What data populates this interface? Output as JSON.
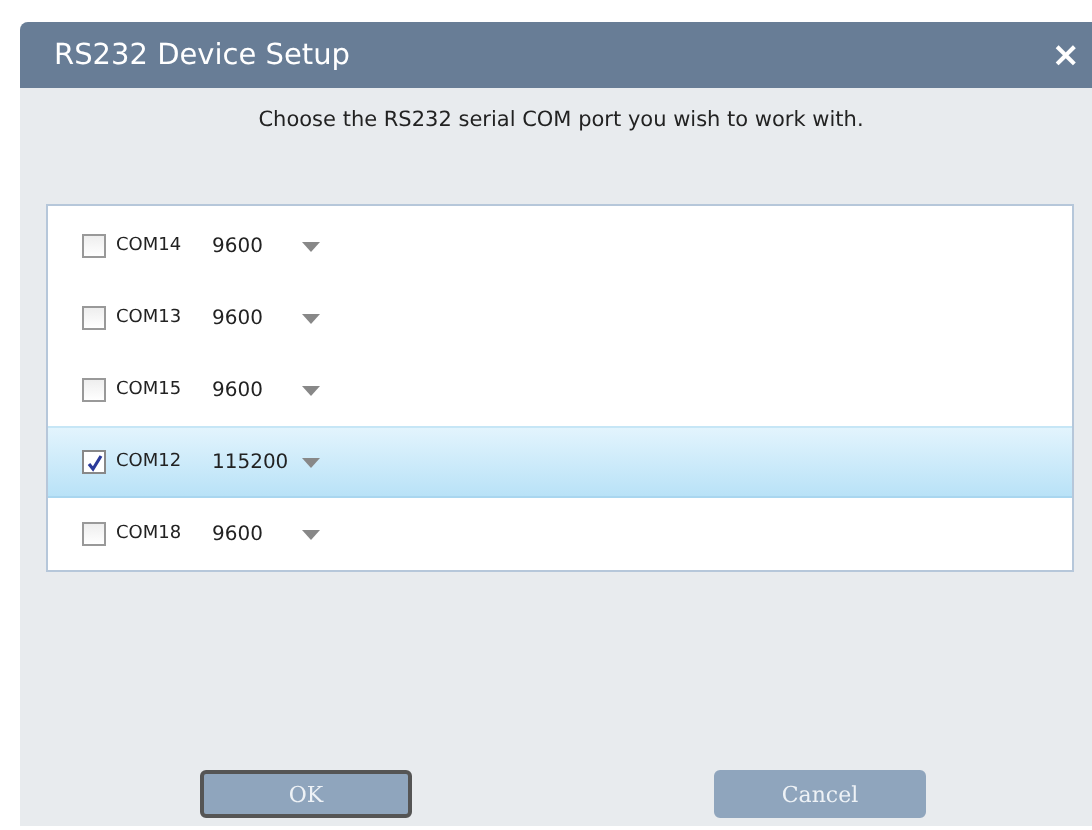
{
  "window": {
    "title": "RS232 Device Setup",
    "close": "×"
  },
  "instruction": "Choose the RS232 serial COM port you wish to work with.",
  "ports": [
    {
      "name": "COM14",
      "baud": "9600",
      "checked": false,
      "selected": false
    },
    {
      "name": "COM13",
      "baud": "9600",
      "checked": false,
      "selected": false
    },
    {
      "name": "COM15",
      "baud": "9600",
      "checked": false,
      "selected": false
    },
    {
      "name": "COM12",
      "baud": "115200",
      "checked": true,
      "selected": true
    },
    {
      "name": "COM18",
      "baud": "9600",
      "checked": false,
      "selected": false
    }
  ],
  "buttons": [
    {
      "label": "OK",
      "focused": true
    },
    {
      "label": "Cancel",
      "focused": false
    }
  ]
}
